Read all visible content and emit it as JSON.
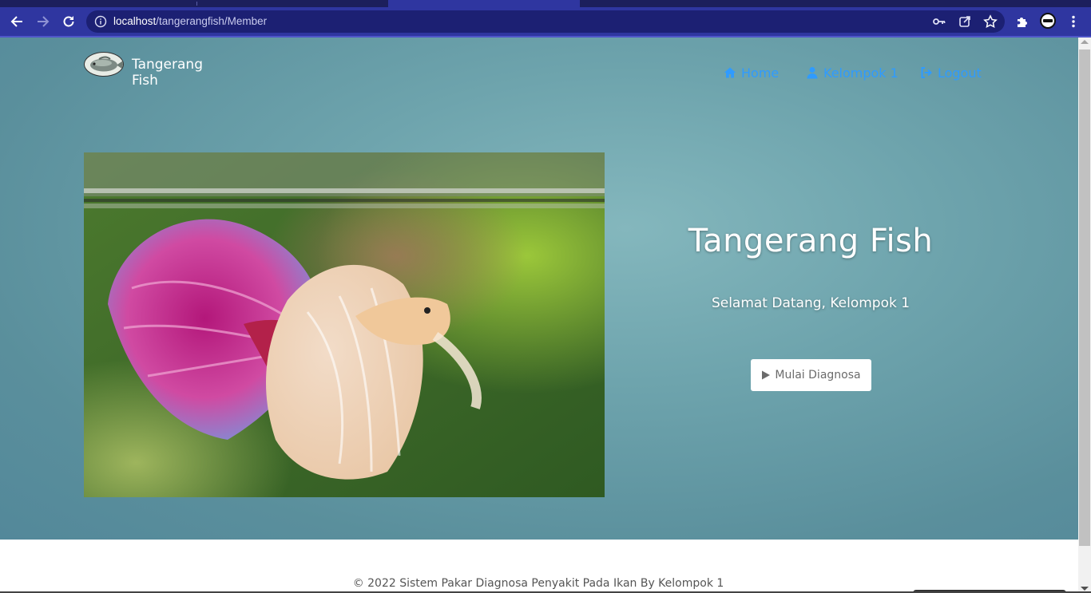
{
  "browser": {
    "url_host": "localhost",
    "url_path": "/tangerangfish/Member"
  },
  "navbar": {
    "brand": "Tangerang Fish",
    "items": [
      {
        "label": "Home",
        "icon": "home-icon"
      },
      {
        "label": "Kelompok 1",
        "icon": "user-icon"
      },
      {
        "label": "Logout",
        "icon": "logout-icon"
      }
    ],
    "link_color": "#2f9bff"
  },
  "hero": {
    "title": "Tangerang Fish",
    "subtitle": "Selamat Datang, Kelompok 1",
    "cta_label": "Mulai Diagnosa",
    "cta_icon": "play-icon"
  },
  "footer": {
    "text": "© 2022 Sistem Pakar Diagnosa Penyakit Pada Ikan By Kelompok 1"
  },
  "colors": {
    "browser_toolbar": "#2f36a0",
    "hero_bg": "#6ea4ad"
  }
}
